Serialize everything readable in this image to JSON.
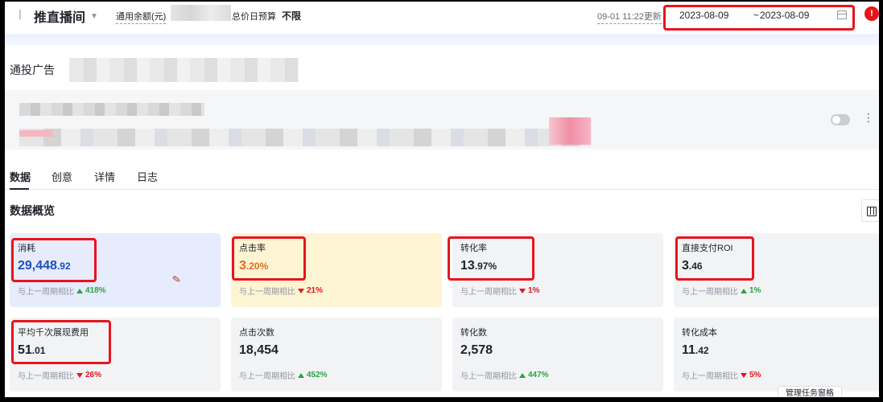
{
  "header": {
    "brand": "推直播间",
    "balance_label": "通用余额(元)",
    "budget_label": "总价日预算",
    "budget_value": "不限",
    "update_time": "09-01 11:22更新",
    "date_start": "2023-08-09",
    "date_sep": "~",
    "date_end": "2023-08-09",
    "alert_glyph": "!"
  },
  "ad": {
    "title": "通投广告"
  },
  "tabs": [
    {
      "label": "数据"
    },
    {
      "label": "创意"
    },
    {
      "label": "详情"
    },
    {
      "label": "日志"
    }
  ],
  "overview": {
    "title": "数据概览",
    "compare_label": "与上一周期相比",
    "cards": [
      {
        "name": "消耗",
        "value_main": "29,448",
        "value_small": ".92",
        "change": "418%",
        "direction": "up"
      },
      {
        "name": "点击率",
        "value_main": "3",
        "value_small": ".20%",
        "change": "21%",
        "direction": "down"
      },
      {
        "name": "转化率",
        "value_main": "13",
        "value_small": ".97%",
        "change": "1%",
        "direction": "down"
      },
      {
        "name": "直接支付ROI",
        "value_main": "3",
        "value_small": ".46",
        "change": "1%",
        "direction": "up"
      },
      {
        "name": "平均千次展现费用",
        "value_main": "51",
        "value_small": ".01",
        "change": "26%",
        "direction": "down"
      },
      {
        "name": "点击次数",
        "value_main": "18,454",
        "value_small": "",
        "change": "452%",
        "direction": "up"
      },
      {
        "name": "转化数",
        "value_main": "2,578",
        "value_small": "",
        "change": "447%",
        "direction": "up"
      },
      {
        "name": "转化成本",
        "value_main": "11",
        "value_small": ".42",
        "change": "5%",
        "direction": "down"
      }
    ]
  },
  "tooltip": "管理任务窗格",
  "colors": {
    "highlight_red": "#e8141c",
    "up_green": "#2ba246",
    "down_red": "#e8141c",
    "blue_value": "#1d4fc4",
    "orange_value": "#e56b1f"
  }
}
